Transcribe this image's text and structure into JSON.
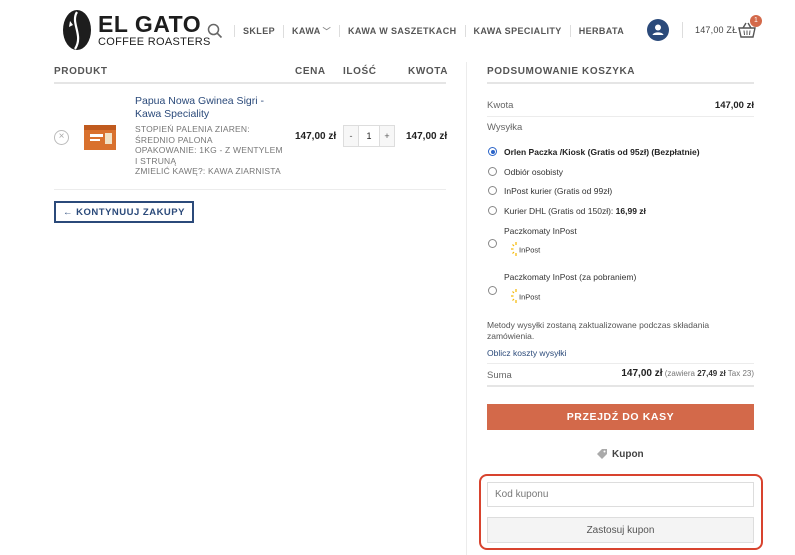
{
  "brand": {
    "title": "EL GATO",
    "subtitle": "COFFEE ROASTERS"
  },
  "nav": {
    "search_icon": "search-icon",
    "items": [
      {
        "label": "SKLEP"
      },
      {
        "label": "KAWA",
        "has_dropdown": true
      },
      {
        "label": "KAWA W SASZETKACH"
      },
      {
        "label": "KAWA SPECIALITY"
      },
      {
        "label": "HERBATA"
      }
    ]
  },
  "header": {
    "account_icon": "user-icon",
    "cart_total": "147,00 ZŁ",
    "cart_icon": "basket-icon",
    "cart_count": "1"
  },
  "cart": {
    "columns": {
      "product": "PRODUKT",
      "price": "CENA",
      "quantity": "ILOŚĆ",
      "subtotal": "KWOTA"
    },
    "items": [
      {
        "name": "Papua Nowa Gwinea Sigri - Kawa Speciality",
        "meta": [
          "STOPIEŃ PALENIA ZIAREN: ŚREDNIO PALONA",
          "OPAKOWANIE: 1KG - Z WENTYLEM I STRUNĄ",
          "ZMIELIĆ KAWĘ?: KAWA ZIARNISTA"
        ],
        "price": "147,00 zł",
        "quantity": "1",
        "subtotal": "147,00 zł",
        "remove_symbol": "×",
        "qty_minus": "-",
        "qty_plus": "+"
      }
    ],
    "continue_label": "← KONTYNUUJ ZAKUPY"
  },
  "summary": {
    "title": "PODSUMOWANIE KOSZYKA",
    "subtotal_label": "Kwota",
    "subtotal_value": "147,00 zł",
    "shipping_label": "Wysyłka",
    "shipping_options": [
      {
        "label": "Orlen Paczka /Kiosk (Gratis od 95zł) (Bezpłatnie)",
        "selected": true
      },
      {
        "label": "Odbiór osobisty",
        "selected": false
      },
      {
        "label": "InPost kurier (Gratis od 99zł)",
        "selected": false
      },
      {
        "label": "Kurier DHL (Gratis od 150zł):",
        "price": "16,99 zł",
        "selected": false
      },
      {
        "label": "Paczkomaty InPost",
        "logo": "InPost",
        "selected": false
      },
      {
        "label": "Paczkomaty InPost (za pobraniem)",
        "logo": "InPost",
        "selected": false
      }
    ],
    "shipping_note": "Metody wysyłki zostaną zaktualizowane podczas składania zamówienia.",
    "calc_link": "Oblicz koszty wysyłki",
    "total_label": "Suma",
    "total_value": "147,00 zł",
    "tax_prefix": "(zawiera",
    "tax_value": "27,49 zł",
    "tax_suffix": "Tax 23)",
    "checkout_label": "PRZEJDŹ DO KASY",
    "coupon_title": "Kupon",
    "coupon_icon": "tag-icon",
    "coupon_placeholder": "Kod kuponu",
    "coupon_value": "",
    "coupon_button": "Zastosuj kupon"
  },
  "colors": {
    "accent": "#d3694a",
    "link": "#2b4a7a",
    "highlight": "#d8432e"
  }
}
